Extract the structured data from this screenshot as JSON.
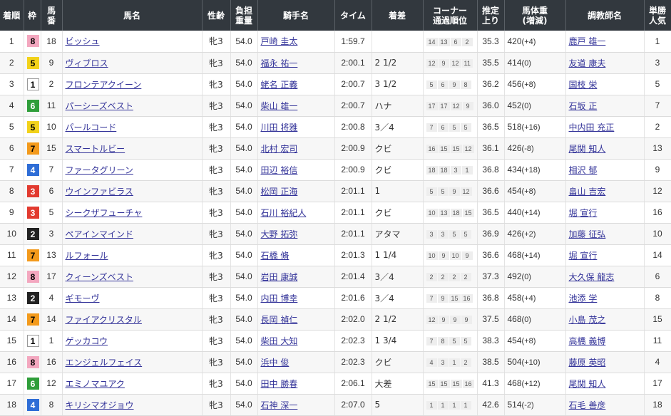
{
  "headers": [
    {
      "line1": "着順"
    },
    {
      "line1": "枠"
    },
    {
      "line1": "馬",
      "line2": "番"
    },
    {
      "line1": "馬名"
    },
    {
      "line1": "性齢"
    },
    {
      "line1": "負担",
      "line2": "重量"
    },
    {
      "line1": "騎手名"
    },
    {
      "line1": "タイム"
    },
    {
      "line1": "着差"
    },
    {
      "line1": "コーナー",
      "line2": "通過順位"
    },
    {
      "line1": "推定",
      "line2": "上り"
    },
    {
      "line1": "馬体重",
      "line2": "(増減)"
    },
    {
      "line1": "調教師名"
    },
    {
      "line1": "単勝",
      "line2": "人気"
    }
  ],
  "waku_colors": {
    "1": {
      "bg": "#ffffff",
      "fg": "#000000",
      "border": "#999999"
    },
    "2": {
      "bg": "#222222",
      "fg": "#ffffff",
      "border": "#222222"
    },
    "3": {
      "bg": "#e23a2f",
      "fg": "#ffffff",
      "border": "#e23a2f"
    },
    "4": {
      "bg": "#2e6dd6",
      "fg": "#ffffff",
      "border": "#2e6dd6"
    },
    "5": {
      "bg": "#f2d21b",
      "fg": "#000000",
      "border": "#f2d21b"
    },
    "6": {
      "bg": "#2f9e3a",
      "fg": "#ffffff",
      "border": "#2f9e3a"
    },
    "7": {
      "bg": "#f39a1c",
      "fg": "#000000",
      "border": "#f39a1c"
    },
    "8": {
      "bg": "#f3a7bf",
      "fg": "#000000",
      "border": "#f3a7bf"
    }
  },
  "rows": [
    {
      "rank": "1",
      "waku": "8",
      "umaban": "18",
      "horse": "ビッシュ",
      "sexage": "牝3",
      "weight": "54.0",
      "jockey": "戸崎 圭太",
      "time": "1:59.7",
      "margin": "",
      "pass": [
        "14",
        "13",
        "6",
        "2"
      ],
      "last": "35.3",
      "bw": "420",
      "bwdiff": "(+4)",
      "trainer": "鹿戸 雄一",
      "pop": "1"
    },
    {
      "rank": "2",
      "waku": "5",
      "umaban": "9",
      "horse": "ヴィブロス",
      "sexage": "牝3",
      "weight": "54.0",
      "jockey": "福永 祐一",
      "time": "2:00.1",
      "margin": "2 1/2",
      "pass": [
        "12",
        "9",
        "12",
        "11"
      ],
      "last": "35.5",
      "bw": "414",
      "bwdiff": "(0)",
      "trainer": "友道 康夫",
      "pop": "3"
    },
    {
      "rank": "3",
      "waku": "1",
      "umaban": "2",
      "horse": "フロンテアクイーン",
      "sexage": "牝3",
      "weight": "54.0",
      "jockey": "蛯名 正義",
      "time": "2:00.7",
      "margin": "3 1/2",
      "pass": [
        "5",
        "6",
        "9",
        "8"
      ],
      "last": "36.2",
      "bw": "456",
      "bwdiff": "(+8)",
      "trainer": "国枝 栄",
      "pop": "5"
    },
    {
      "rank": "4",
      "waku": "6",
      "umaban": "11",
      "horse": "パーシーズベスト",
      "sexage": "牝3",
      "weight": "54.0",
      "jockey": "柴山 雄一",
      "time": "2:00.7",
      "margin": "ハナ",
      "pass": [
        "17",
        "17",
        "12",
        "9"
      ],
      "last": "36.0",
      "bw": "452",
      "bwdiff": "(0)",
      "trainer": "石坂 正",
      "pop": "7"
    },
    {
      "rank": "5",
      "waku": "5",
      "umaban": "10",
      "horse": "パールコード",
      "sexage": "牝3",
      "weight": "54.0",
      "jockey": "川田 将雅",
      "time": "2:00.8",
      "margin": "3／4",
      "pass": [
        "7",
        "6",
        "5",
        "5"
      ],
      "last": "36.5",
      "bw": "518",
      "bwdiff": "(+16)",
      "trainer": "中内田 充正",
      "pop": "2"
    },
    {
      "rank": "6",
      "waku": "7",
      "umaban": "15",
      "horse": "スマートルビー",
      "sexage": "牝3",
      "weight": "54.0",
      "jockey": "北村 宏司",
      "time": "2:00.9",
      "margin": "クビ",
      "pass": [
        "16",
        "15",
        "15",
        "12"
      ],
      "last": "36.1",
      "bw": "426",
      "bwdiff": "(-8)",
      "trainer": "尾関 知人",
      "pop": "13"
    },
    {
      "rank": "7",
      "waku": "4",
      "umaban": "7",
      "horse": "ファータグリーン",
      "sexage": "牝3",
      "weight": "54.0",
      "jockey": "田辺 裕信",
      "time": "2:00.9",
      "margin": "クビ",
      "pass": [
        "18",
        "18",
        "3",
        "1"
      ],
      "last": "36.8",
      "bw": "434",
      "bwdiff": "(+18)",
      "trainer": "相沢 郁",
      "pop": "9"
    },
    {
      "rank": "8",
      "waku": "3",
      "umaban": "6",
      "horse": "ウインファビラス",
      "sexage": "牝3",
      "weight": "54.0",
      "jockey": "松岡 正海",
      "time": "2:01.1",
      "margin": "1",
      "pass": [
        "5",
        "5",
        "9",
        "12"
      ],
      "last": "36.6",
      "bw": "454",
      "bwdiff": "(+8)",
      "trainer": "畠山 吉宏",
      "pop": "12"
    },
    {
      "rank": "9",
      "waku": "3",
      "umaban": "5",
      "horse": "シークザフューチャ",
      "sexage": "牝3",
      "weight": "54.0",
      "jockey": "石川 裕紀人",
      "time": "2:01.1",
      "margin": "クビ",
      "pass": [
        "10",
        "13",
        "18",
        "15"
      ],
      "last": "36.5",
      "bw": "440",
      "bwdiff": "(+14)",
      "trainer": "堀 宣行",
      "pop": "16"
    },
    {
      "rank": "10",
      "waku": "2",
      "umaban": "3",
      "horse": "ペアインマインド",
      "sexage": "牝3",
      "weight": "54.0",
      "jockey": "大野 拓弥",
      "time": "2:01.1",
      "margin": "アタマ",
      "pass": [
        "3",
        "3",
        "5",
        "5"
      ],
      "last": "36.9",
      "bw": "426",
      "bwdiff": "(+2)",
      "trainer": "加藤 征弘",
      "pop": "10"
    },
    {
      "rank": "11",
      "waku": "7",
      "umaban": "13",
      "horse": "ルフォール",
      "sexage": "牝3",
      "weight": "54.0",
      "jockey": "石橋 脩",
      "time": "2:01.3",
      "margin": "1 1/4",
      "pass": [
        "10",
        "9",
        "10",
        "9"
      ],
      "last": "36.6",
      "bw": "468",
      "bwdiff": "(+14)",
      "trainer": "堀 宣行",
      "pop": "14"
    },
    {
      "rank": "12",
      "waku": "8",
      "umaban": "17",
      "horse": "クィーンズベスト",
      "sexage": "牝3",
      "weight": "54.0",
      "jockey": "岩田 康誠",
      "time": "2:01.4",
      "margin": "3／4",
      "pass": [
        "2",
        "2",
        "2",
        "2"
      ],
      "last": "37.3",
      "bw": "492",
      "bwdiff": "(0)",
      "trainer": "大久保 龍志",
      "pop": "6"
    },
    {
      "rank": "13",
      "waku": "2",
      "umaban": "4",
      "horse": "ギモーヴ",
      "sexage": "牝3",
      "weight": "54.0",
      "jockey": "内田 博幸",
      "time": "2:01.6",
      "margin": "3／4",
      "pass": [
        "7",
        "9",
        "15",
        "16"
      ],
      "last": "36.8",
      "bw": "458",
      "bwdiff": "(+4)",
      "trainer": "池添 学",
      "pop": "8"
    },
    {
      "rank": "14",
      "waku": "7",
      "umaban": "14",
      "horse": "ファイアクリスタル",
      "sexage": "牝3",
      "weight": "54.0",
      "jockey": "長岡 禎仁",
      "time": "2:02.0",
      "margin": "2 1/2",
      "pass": [
        "12",
        "9",
        "9",
        "9"
      ],
      "last": "37.5",
      "bw": "468",
      "bwdiff": "(0)",
      "trainer": "小島 茂之",
      "pop": "15"
    },
    {
      "rank": "15",
      "waku": "1",
      "umaban": "1",
      "horse": "ゲッカコウ",
      "sexage": "牝3",
      "weight": "54.0",
      "jockey": "柴田 大知",
      "time": "2:02.3",
      "margin": "1 3/4",
      "pass": [
        "7",
        "8",
        "5",
        "5"
      ],
      "last": "38.3",
      "bw": "454",
      "bwdiff": "(+8)",
      "trainer": "高橋 義博",
      "pop": "11"
    },
    {
      "rank": "16",
      "waku": "8",
      "umaban": "16",
      "horse": "エンジェルフェイス",
      "sexage": "牝3",
      "weight": "54.0",
      "jockey": "浜中 俊",
      "time": "2:02.3",
      "margin": "クビ",
      "pass": [
        "4",
        "3",
        "1",
        "2"
      ],
      "last": "38.5",
      "bw": "504",
      "bwdiff": "(+10)",
      "trainer": "藤原 英昭",
      "pop": "4"
    },
    {
      "rank": "17",
      "waku": "6",
      "umaban": "12",
      "horse": "エミノマユアク",
      "sexage": "牝3",
      "weight": "54.0",
      "jockey": "田中 勝春",
      "time": "2:06.1",
      "margin": "大差",
      "pass": [
        "15",
        "15",
        "15",
        "16"
      ],
      "last": "41.3",
      "bw": "468",
      "bwdiff": "(+12)",
      "trainer": "尾関 知人",
      "pop": "17"
    },
    {
      "rank": "18",
      "waku": "4",
      "umaban": "8",
      "horse": "キリシマオジョウ",
      "sexage": "牝3",
      "weight": "54.0",
      "jockey": "石神 深一",
      "time": "2:07.0",
      "margin": "5",
      "pass": [
        "1",
        "1",
        "1",
        "1"
      ],
      "last": "42.6",
      "bw": "514",
      "bwdiff": "(-2)",
      "trainer": "石毛 善彦",
      "pop": "18"
    }
  ]
}
